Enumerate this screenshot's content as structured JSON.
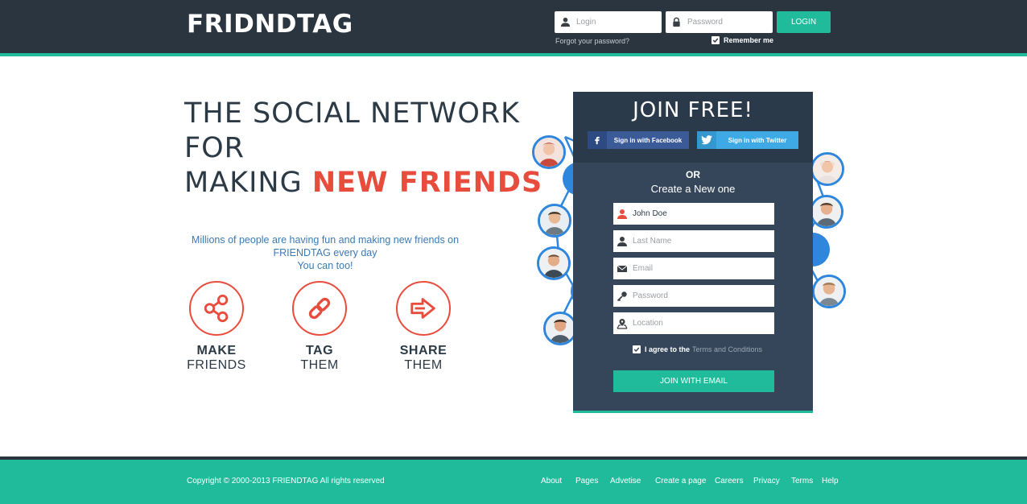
{
  "header": {
    "logo": "FRIDNDTAG",
    "login_placeholder": "Login",
    "password_placeholder": "Password",
    "login_button": "LOGIN",
    "forgot": "Forgot your password?",
    "remember": "Remember me",
    "remember_checked": true
  },
  "hero": {
    "line1": "THE SOCIAL NETWORK",
    "line2": "FOR",
    "line3_plain": "MAKING ",
    "line3_accent": "NEW FRIENDS",
    "sub1": "Millions of people are having fun and making new friends on",
    "sub2": "FRIENDTAG every day",
    "sub3": "You can too!",
    "features": [
      {
        "t1": "MAKE",
        "t2": "FRIENDS",
        "icon": "share-icon"
      },
      {
        "t1": "TAG",
        "t2": "THEM",
        "icon": "link-icon"
      },
      {
        "t1": "SHARE",
        "t2": "THEM",
        "icon": "arrow-right-icon"
      }
    ]
  },
  "join": {
    "title": "JOIN FREE!",
    "facebook": "Sign in with Facebook",
    "twitter": "Sign in with Twitter",
    "or": "OR",
    "create": "Create a New one",
    "first_name_value": "John Doe",
    "last_name_placeholder": "Last Name",
    "email_placeholder": "Email",
    "password_placeholder": "Password",
    "location_placeholder": "Location",
    "agree_text": "I agree to the",
    "terms_link": "Terms and Conditions",
    "agree_checked": true,
    "join_button": "JOIN WITH EMAIL"
  },
  "footer": {
    "copyright": "Copyright © 2000-2013 FRIENDTAG All rights reserved",
    "links": [
      "About",
      "Pages",
      "Advetise",
      "Create a page",
      "Careers",
      "Privacy",
      "Terms",
      "Help"
    ]
  },
  "colors": {
    "header_bg": "#2b3540",
    "accent_teal": "#1fbb9b",
    "accent_red": "#e84c3d",
    "panel_bg": "#35465a",
    "facebook": "#3b5a98",
    "twitter": "#3fa9e6",
    "avatar_ring": "#2f86dd"
  }
}
